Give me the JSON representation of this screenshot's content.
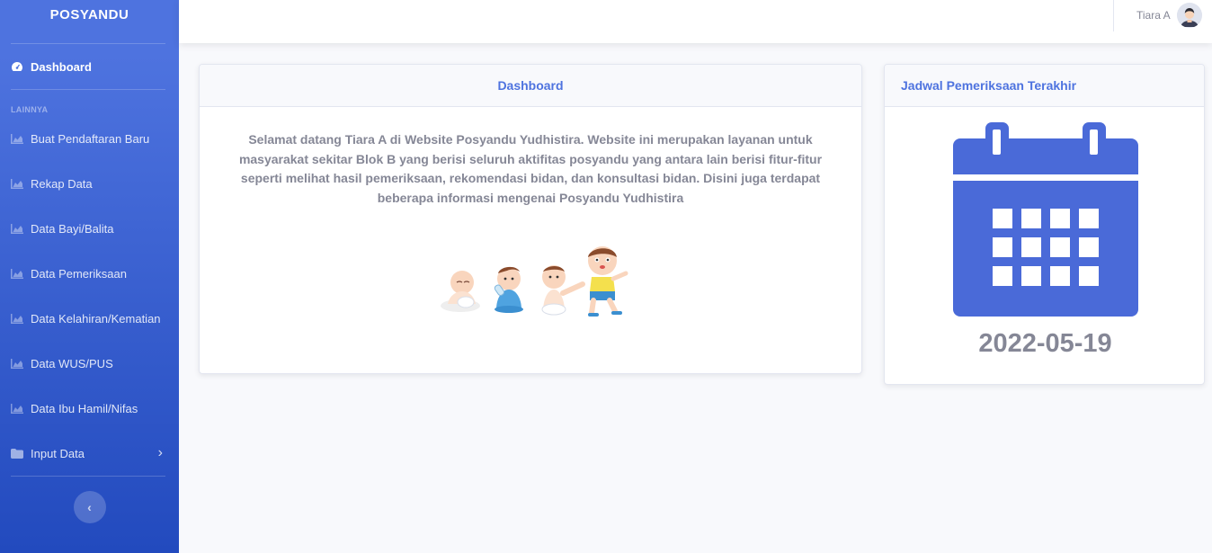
{
  "sidebar": {
    "brand": "POSYANDU",
    "dashboard_label": "Dashboard",
    "heading": "LAINNYA",
    "items": [
      {
        "label": "Buat Pendaftaran Baru",
        "icon": "chart-area-icon"
      },
      {
        "label": "Rekap Data",
        "icon": "chart-area-icon"
      },
      {
        "label": "Data Bayi/Balita",
        "icon": "chart-area-icon"
      },
      {
        "label": "Data Pemeriksaan",
        "icon": "chart-area-icon"
      },
      {
        "label": "Data Kelahiran/Kematian",
        "icon": "chart-area-icon"
      },
      {
        "label": "Data WUS/PUS",
        "icon": "chart-area-icon"
      },
      {
        "label": "Data Ibu Hamil/Nifas",
        "icon": "chart-area-icon"
      }
    ],
    "input_label": "Input Data",
    "colors": {
      "gradient_top": "#4e73df",
      "gradient_bottom": "#224abe"
    }
  },
  "topbar": {
    "user_name": "Tiara A"
  },
  "dashboard_card": {
    "title": "Dashboard",
    "welcome_text": "Selamat datang Tiara A di Website Posyandu Yudhistira. Website ini merupakan layanan untuk masyarakat sekitar Blok B yang berisi seluruh aktifitas posyandu yang antara lain berisi fitur-fitur seperti melihat hasil pemeriksaan, rekomendasi bidan, dan konsultasi bidan. Disini juga terdapat beberapa informasi mengenai Posyandu Yudhistira"
  },
  "schedule_card": {
    "title": "Jadwal Pemeriksaan Terakhir",
    "date": "2022-05-19",
    "icon": "calendar-icon",
    "accent": "#4a6ad8"
  }
}
